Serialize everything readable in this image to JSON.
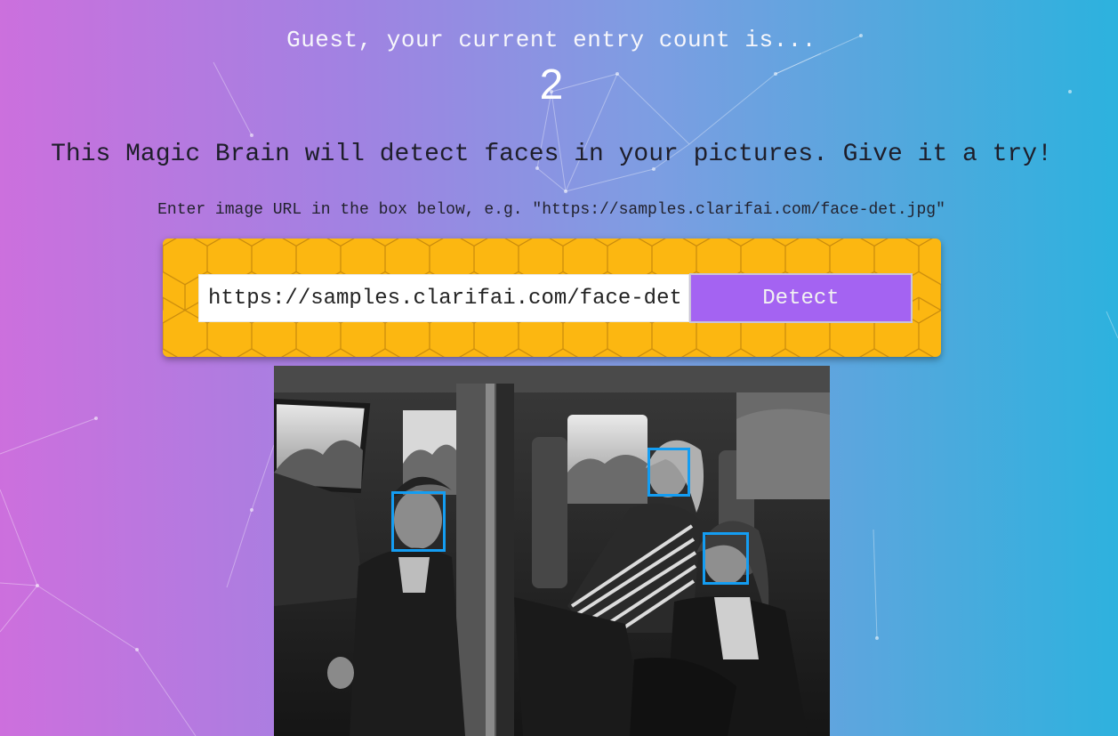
{
  "rank": {
    "message": "Guest, your current entry count is...",
    "count": "2"
  },
  "intro": {
    "text": "This Magic Brain will detect faces in your pictures. Give it a try!"
  },
  "instruction": {
    "text": "Enter image URL in the box below, e.g. \"https://samples.clarifai.com/face-det.jpg\""
  },
  "image_form": {
    "input_value": "https://samples.clarifai.com/face-det.jpg",
    "detect_label": "Detect"
  },
  "face_result": {
    "faces_detected": 3,
    "box_color": "#149df2"
  },
  "colors": {
    "gradient_left": "#cd6fdd",
    "gradient_right": "#2cb2de",
    "panel": "#fcb711",
    "button": "#a463f2"
  }
}
